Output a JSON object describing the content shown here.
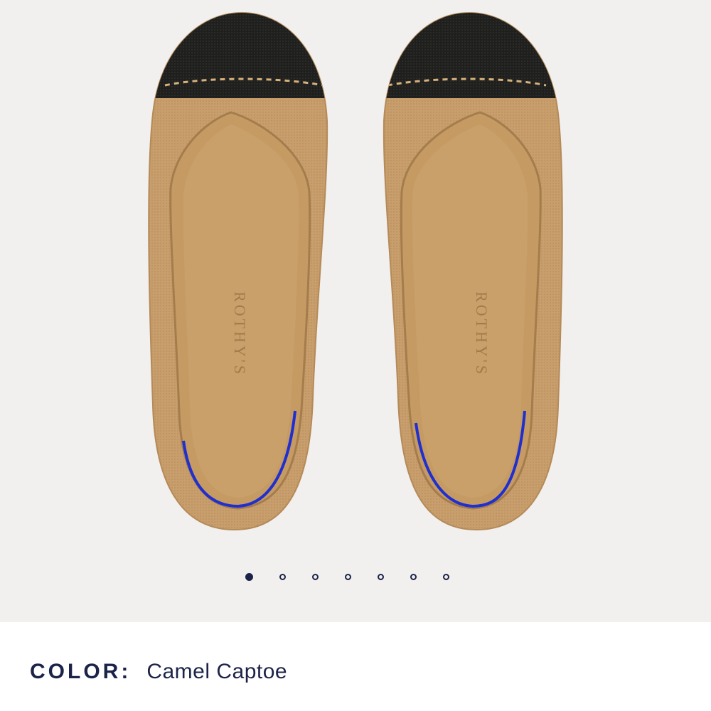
{
  "gallery": {
    "brand_insole_text": "ROTHY'S",
    "slide_count": 7,
    "active_slide": 1,
    "slides": [
      {
        "label": "Image 1"
      },
      {
        "label": "Image 2"
      },
      {
        "label": "Image 3"
      },
      {
        "label": "Image 4"
      },
      {
        "label": "Image 5"
      },
      {
        "label": "Image 6"
      },
      {
        "label": "Image 7"
      }
    ]
  },
  "product": {
    "color_label": "COLOR:",
    "color_value": "Camel Captoe"
  },
  "colors": {
    "background": "#f1f0ee",
    "accent_navy": "#1c2348",
    "camel": "#c9a06f",
    "captoe": "#1d1d1b",
    "heel_stripe": "#2233c8"
  }
}
